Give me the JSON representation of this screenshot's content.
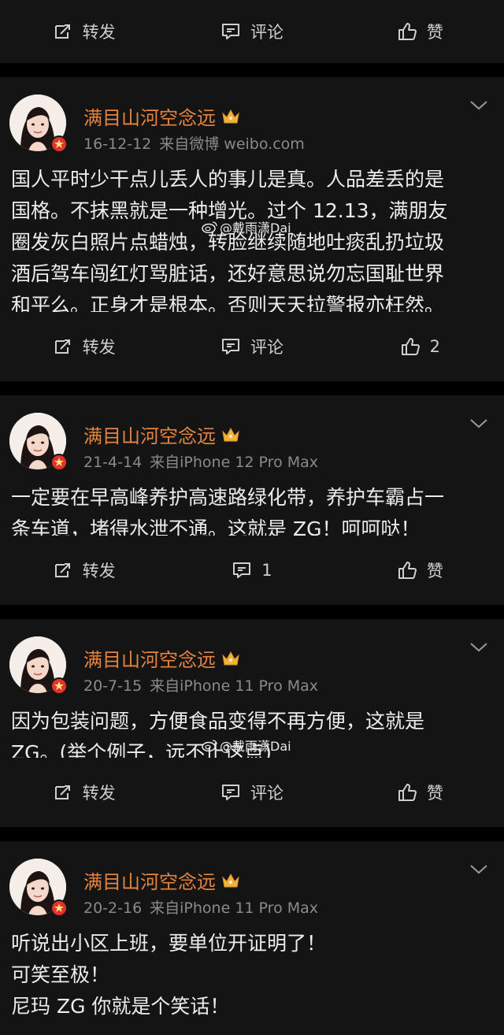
{
  "top_actions": {
    "repost": "转发",
    "comment": "评论",
    "like": "赞"
  },
  "watermark": "@戴雨潇Dai",
  "posts": [
    {
      "username": "满目山河空念远",
      "date": "16-12-12",
      "source": "来自微博 weibo.com",
      "text": "国人平时少干点儿丢人的事儿是真。人品差丢的是\n国格。不抹黑就是一种增光。过个 12.13，满朋友\n圈发灰白照片点蜡烛，转脸继续随地吐痰乱扔垃圾\n酒后驾车闯红灯骂脏话，还好意思说勿忘国耻世界\n和平么。正身才是根本。否则天天拉警报亦枉然。",
      "actions": {
        "repost": "转发",
        "comment": "评论",
        "like": "2"
      }
    },
    {
      "username": "满目山河空念远",
      "date": "21-4-14",
      "source": "来自iPhone 12 Pro Max",
      "text": "一定要在早高峰养护高速路绿化带，养护车霸占一\n条车道，堵得水泄不通。这就是 ZG！呵呵哒！",
      "actions": {
        "repost": "转发",
        "comment": "1",
        "like": "赞"
      }
    },
    {
      "username": "满目山河空念远",
      "date": "20-7-15",
      "source": "来自iPhone 11 Pro Max",
      "text": "因为包装问题，方便食品变得不再方便，这就是\nZG。(举个例子，远不止这点)",
      "actions": {
        "repost": "转发",
        "comment": "评论",
        "like": "赞"
      }
    },
    {
      "username": "满目山河空念远",
      "date": "20-2-16",
      "source": "来自iPhone 11 Pro Max",
      "text": "听说出小区上班，要单位开证明了！\n可笑至极！\n尼玛 ZG 你就是个笑话！"
    }
  ]
}
